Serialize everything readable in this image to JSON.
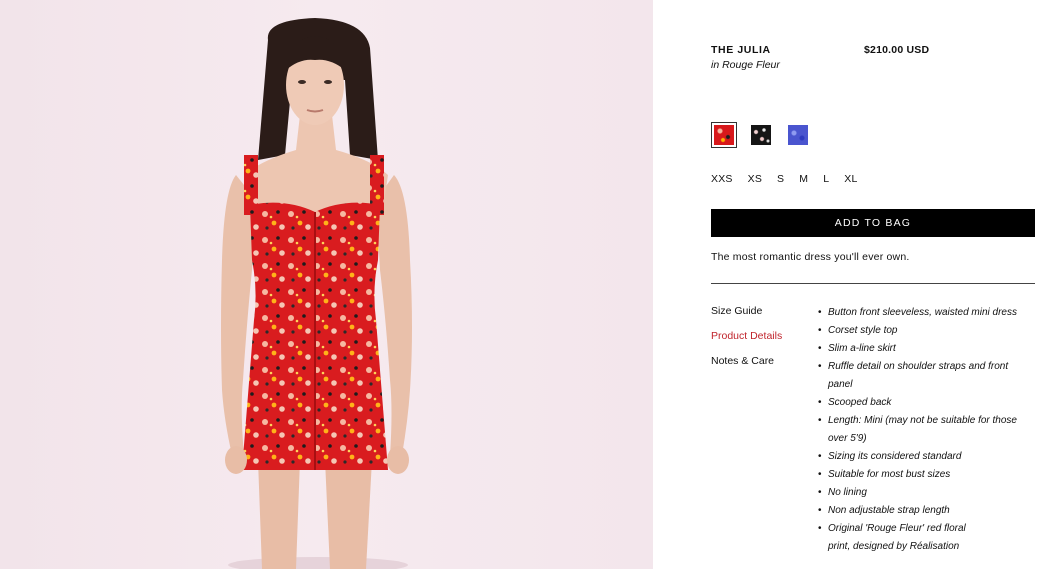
{
  "product": {
    "title": "THE JULIA",
    "variant_name": "in Rouge Fleur",
    "price": "$210.00 USD",
    "image_alt": "Model wearing red floral button-front mini dress"
  },
  "colors": {
    "accent": "#c0242c",
    "button_bg": "#000000",
    "swatches": [
      {
        "name": "red",
        "hex": "#d8181b"
      },
      {
        "name": "black",
        "hex": "#151515"
      },
      {
        "name": "blue",
        "hex": "#4a55cf"
      }
    ]
  },
  "sizes": [
    "XXS",
    "XS",
    "S",
    "M",
    "L",
    "XL"
  ],
  "cta": {
    "add_to_bag": "ADD TO BAG"
  },
  "tagline": "The most romantic dress you'll ever own.",
  "tabs": [
    {
      "label": "Size Guide",
      "active": false
    },
    {
      "label": "Product Details",
      "active": true
    },
    {
      "label": "Notes & Care",
      "active": false
    }
  ],
  "details": [
    [
      "Button front sleeveless, waisted mini dress"
    ],
    [
      "Corset style top"
    ],
    [
      "Slim a-line skirt"
    ],
    [
      "Ruffle detail on shoulder straps and front",
      "panel"
    ],
    [
      "Scooped back"
    ],
    [
      "Length: Mini (may not be suitable for those",
      "over 5'9)"
    ],
    [
      "Sizing its considered standard"
    ],
    [
      "Suitable for most bust sizes"
    ],
    [
      "No lining"
    ],
    [
      "Non adjustable strap length"
    ],
    [
      "Original 'Rouge Fleur' red floral",
      "print, designed by Réalisation"
    ]
  ]
}
